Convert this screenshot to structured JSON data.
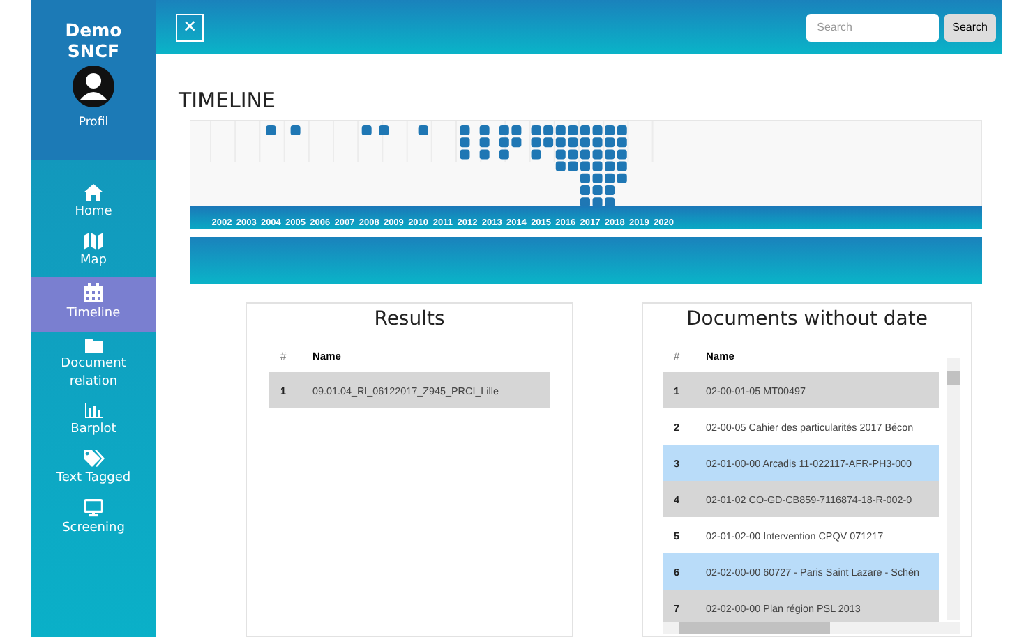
{
  "sidebar": {
    "brand": "Demo SNCF",
    "profile": "Profil",
    "items": [
      {
        "label": "Home",
        "selected": false
      },
      {
        "label": "Map",
        "selected": false
      },
      {
        "label": "Timeline",
        "selected": true
      },
      {
        "label": "Document relation",
        "selected": false
      },
      {
        "label": "Barplot",
        "selected": false
      },
      {
        "label": "Text Tagged",
        "selected": false
      },
      {
        "label": "Screening",
        "selected": false
      }
    ]
  },
  "topbar": {
    "close": "×",
    "search": {
      "placeholder": "Search"
    },
    "search_button": "Search"
  },
  "title": "TIMELINE",
  "timeline": {
    "years": [
      "2002",
      "2003",
      "2004",
      "2005",
      "2006",
      "2007",
      "2008",
      "2009",
      "2010",
      "2011",
      "2012",
      "2013",
      "2014",
      "2015",
      "2016",
      "2017",
      "2018",
      "2019",
      "2020"
    ]
  },
  "results": {
    "title": "Results",
    "columns": [
      "#",
      "Name"
    ],
    "rows": [
      {
        "index": "1",
        "name": "09.01.04_RI_06122017_Z945_PRCI_Lille",
        "color": "#d6d6d6"
      }
    ]
  },
  "undated": {
    "title": "Documents without date",
    "columns": [
      "#",
      "Name"
    ],
    "rows": [
      {
        "index": "1",
        "name": "02-00-01-05 MT00497",
        "color": "#d6d6d6"
      },
      {
        "index": "2",
        "name": "02-00-05 Cahier des particularités 2017 Bécon",
        "color": "#ffffff"
      },
      {
        "index": "3",
        "name": "02-01-00-00 Arcadis 11-022117-AFR-PH3-000",
        "color": "#b9dcf9"
      },
      {
        "index": "4",
        "name": "02-01-02 CO-GD-CB859-7116874-18-R-002-0",
        "color": "#d6d6d6"
      },
      {
        "index": "5",
        "name": "02-01-02-00 Intervention CPQV 071217",
        "color": "#ffffff"
      },
      {
        "index": "6",
        "name": "02-02-00-00 60727 - Paris Saint Lazare - Schén",
        "color": "#b9dcf9"
      },
      {
        "index": "7",
        "name": "02-02-00-00 Plan région PSL 2013",
        "color": "#d6d6d6"
      }
    ]
  }
}
